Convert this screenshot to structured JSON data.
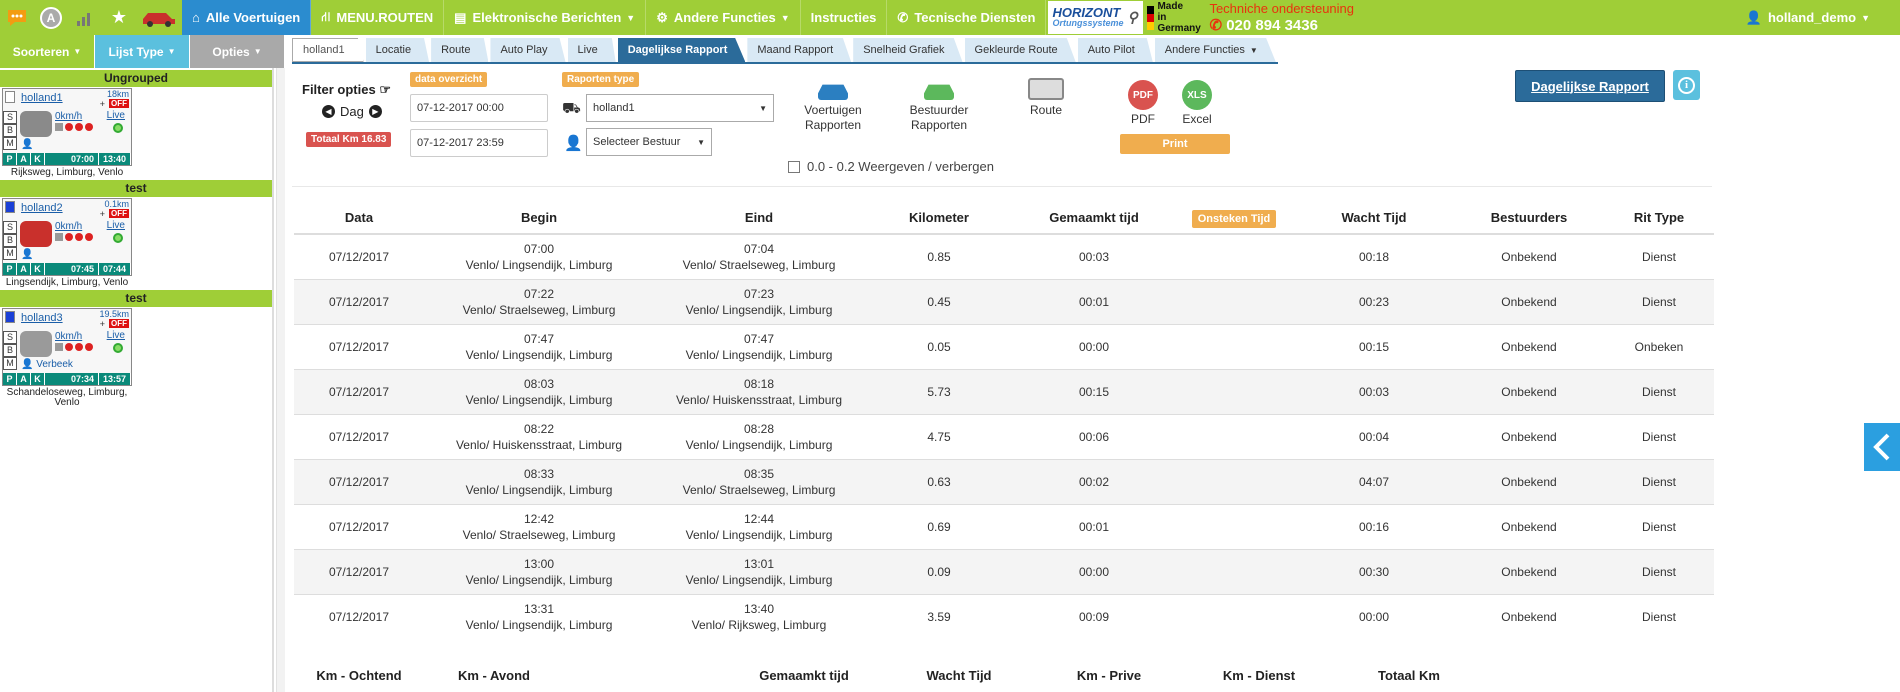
{
  "topnav": {
    "badge_letter": "A",
    "items": [
      {
        "label": "Alle Voertuigen",
        "icon": "home-icon"
      },
      {
        "label": "MENU.ROUTEN",
        "icon": "road-icon"
      },
      {
        "label": "Elektronische Berichten",
        "icon": "document-icon"
      },
      {
        "label": "Andere Functies",
        "icon": "gear-icon"
      },
      {
        "label": "Instructies",
        "icon": ""
      },
      {
        "label": "Tecnische Diensten",
        "icon": "phone-icon"
      }
    ],
    "logo_line1": "HORIZONT",
    "logo_line2": "Ortungssysteme",
    "made_in": [
      "Made",
      "in",
      "Germany"
    ],
    "support_title": "Techniche ondersteuning",
    "support_phone": "020 894 3436",
    "user": "holland_demo"
  },
  "subnav": {
    "sort": "Soorteren",
    "list_type": "Lijst Type",
    "options": "Opties"
  },
  "tabs": [
    "holland1",
    "Locatie",
    "Route",
    "Auto Play",
    "Live",
    "Dagelijkse Rapport",
    "Maand Rapport",
    "Snelheid Grafiek",
    "Gekleurde Route",
    "Auto Pilot",
    "Andere Functies"
  ],
  "active_tab": "Dagelijkse Rapport",
  "sidebar": {
    "groups": [
      {
        "title": "Ungrouped",
        "vehicle": {
          "name": "holland1",
          "km": "18km",
          "status": "OFF",
          "speed": "0km/h",
          "live": "Live",
          "driver": "",
          "p_time": "07:00",
          "k_time": "13:40",
          "address": "Rijksweg, Limburg, Venlo",
          "car_color": "#8a8a8a"
        }
      },
      {
        "title": "test",
        "vehicle": {
          "name": "holland2",
          "km": "0.1km",
          "status": "OFF",
          "speed": "0km/h",
          "live": "Live",
          "driver": "",
          "p_time": "07:45",
          "k_time": "07:44",
          "address": "Lingsendijk, Limburg, Venlo",
          "car_color": "#c9302c"
        }
      },
      {
        "title": "test",
        "vehicle": {
          "name": "holland3",
          "km": "19.5km",
          "status": "OFF",
          "speed": "0km/h",
          "live": "Live",
          "driver": "Verbeek",
          "p_time": "07:34",
          "k_time": "13:57",
          "address": "Schandeloseweg, Limburg, Venlo",
          "car_color": "#9a9a9a"
        }
      }
    ],
    "pak": [
      "P",
      "A",
      "K"
    ],
    "side_letters": [
      "S",
      "B",
      "M"
    ]
  },
  "filters": {
    "title": "Filter opties",
    "day_label": "Dag",
    "total_km": "Totaal Km 16.83",
    "data_badge": "data overzicht",
    "from": "07-12-2017 00:00",
    "to": "07-12-2017 23:59",
    "type_badge": "Raporten type",
    "vehicle_select": "holland1",
    "driver_select": "Selecteer Bestuur",
    "vehicle_reports": "Voertuigen Rapporten",
    "driver_reports": "Bestuurder Rapporten",
    "route": "Route",
    "pdf": "PDF",
    "excel": "Excel",
    "print": "Print",
    "toggle_label": "0.0 - 0.2 Weergeven / verbergen",
    "daily_report_btn": "Dagelijkse Rapport",
    "info": "i"
  },
  "table": {
    "headers": [
      "Data",
      "Begin",
      "Eind",
      "Kilometer",
      "Gemaamkt tijd",
      "Onsteken Tijd",
      "Wacht Tijd",
      "Bestuurders",
      "Rit Type"
    ],
    "rows": [
      {
        "date": "07/12/2017",
        "begin_time": "07:00",
        "begin_place": "Venlo/ Lingsendijk, Limburg",
        "end_time": "07:04",
        "end_place": "Venlo/ Straelseweg, Limburg",
        "km": "0.85",
        "made": "00:03",
        "ign": "",
        "wait": "00:18",
        "driver": "Onbekend",
        "type": "Dienst"
      },
      {
        "date": "07/12/2017",
        "begin_time": "07:22",
        "begin_place": "Venlo/ Straelseweg, Limburg",
        "end_time": "07:23",
        "end_place": "Venlo/ Lingsendijk, Limburg",
        "km": "0.45",
        "made": "00:01",
        "ign": "",
        "wait": "00:23",
        "driver": "Onbekend",
        "type": "Dienst"
      },
      {
        "date": "07/12/2017",
        "begin_time": "07:47",
        "begin_place": "Venlo/ Lingsendijk, Limburg",
        "end_time": "07:47",
        "end_place": "Venlo/ Lingsendijk, Limburg",
        "km": "0.05",
        "made": "00:00",
        "ign": "",
        "wait": "00:15",
        "driver": "Onbekend",
        "type": "Onbeken"
      },
      {
        "date": "07/12/2017",
        "begin_time": "08:03",
        "begin_place": "Venlo/ Lingsendijk, Limburg",
        "end_time": "08:18",
        "end_place": "Venlo/ Huiskensstraat, Limburg",
        "km": "5.73",
        "made": "00:15",
        "ign": "",
        "wait": "00:03",
        "driver": "Onbekend",
        "type": "Dienst"
      },
      {
        "date": "07/12/2017",
        "begin_time": "08:22",
        "begin_place": "Venlo/ Huiskensstraat, Limburg",
        "end_time": "08:28",
        "end_place": "Venlo/ Lingsendijk, Limburg",
        "km": "4.75",
        "made": "00:06",
        "ign": "",
        "wait": "00:04",
        "driver": "Onbekend",
        "type": "Dienst"
      },
      {
        "date": "07/12/2017",
        "begin_time": "08:33",
        "begin_place": "Venlo/ Lingsendijk, Limburg",
        "end_time": "08:35",
        "end_place": "Venlo/ Straelseweg, Limburg",
        "km": "0.63",
        "made": "00:02",
        "ign": "",
        "wait": "04:07",
        "driver": "Onbekend",
        "type": "Dienst"
      },
      {
        "date": "07/12/2017",
        "begin_time": "12:42",
        "begin_place": "Venlo/ Straelseweg, Limburg",
        "end_time": "12:44",
        "end_place": "Venlo/ Lingsendijk, Limburg",
        "km": "0.69",
        "made": "00:01",
        "ign": "",
        "wait": "00:16",
        "driver": "Onbekend",
        "type": "Dienst"
      },
      {
        "date": "07/12/2017",
        "begin_time": "13:00",
        "begin_place": "Venlo/ Lingsendijk, Limburg",
        "end_time": "13:01",
        "end_place": "Venlo/ Lingsendijk, Limburg",
        "km": "0.09",
        "made": "00:00",
        "ign": "",
        "wait": "00:30",
        "driver": "Onbekend",
        "type": "Dienst"
      },
      {
        "date": "07/12/2017",
        "begin_time": "13:31",
        "begin_place": "Venlo/ Lingsendijk, Limburg",
        "end_time": "13:40",
        "end_place": "Venlo/ Rijksweg, Limburg",
        "km": "3.59",
        "made": "00:09",
        "ign": "",
        "wait": "00:00",
        "driver": "Onbekend",
        "type": "Dienst"
      }
    ]
  },
  "summary": [
    "Km - Ochtend",
    "Km - Avond",
    "",
    "Gemaamkt tijd",
    "Wacht Tijd",
    "Km - Prive",
    "Km - Dienst",
    "Totaal Km"
  ],
  "colors": {
    "green": "#9fce37",
    "blue": "#2b8ccf",
    "navy": "#2b6b9a",
    "orange": "#f0ad4e",
    "red": "#d9534f"
  }
}
